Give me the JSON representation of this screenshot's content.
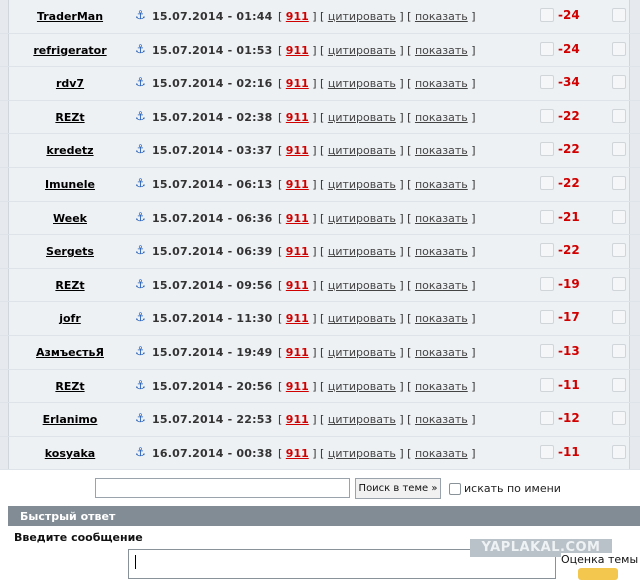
{
  "posts": [
    {
      "user": "TraderMan",
      "anchor": "⚓",
      "date": "15.07.2014 - 01:44",
      "n911": "911",
      "quote": "цитировать",
      "show": "показать",
      "score": "-24"
    },
    {
      "user": "refrigerator",
      "anchor": "⚓",
      "date": "15.07.2014 - 01:53",
      "n911": "911",
      "quote": "цитировать",
      "show": "показать",
      "score": "-24"
    },
    {
      "user": "rdv7",
      "anchor": "⚓",
      "date": "15.07.2014 - 02:16",
      "n911": "911",
      "quote": "цитировать",
      "show": "показать",
      "score": "-34"
    },
    {
      "user": "REZt",
      "anchor": "⚓",
      "date": "15.07.2014 - 02:38",
      "n911": "911",
      "quote": "цитировать",
      "show": "показать",
      "score": "-22"
    },
    {
      "user": "kredetz",
      "anchor": "⚓",
      "date": "15.07.2014 - 03:37",
      "n911": "911",
      "quote": "цитировать",
      "show": "показать",
      "score": "-22"
    },
    {
      "user": "Imunele",
      "anchor": "⚓",
      "date": "15.07.2014 - 06:13",
      "n911": "911",
      "quote": "цитировать",
      "show": "показать",
      "score": "-22"
    },
    {
      "user": "Week",
      "anchor": "⚓",
      "date": "15.07.2014 - 06:36",
      "n911": "911",
      "quote": "цитировать",
      "show": "показать",
      "score": "-21"
    },
    {
      "user": "Sergets",
      "anchor": "⚓",
      "date": "15.07.2014 - 06:39",
      "n911": "911",
      "quote": "цитировать",
      "show": "показать",
      "score": "-22"
    },
    {
      "user": "REZt",
      "anchor": "⚓",
      "date": "15.07.2014 - 09:56",
      "n911": "911",
      "quote": "цитировать",
      "show": "показать",
      "score": "-19"
    },
    {
      "user": "jofr",
      "anchor": "⚓",
      "date": "15.07.2014 - 11:30",
      "n911": "911",
      "quote": "цитировать",
      "show": "показать",
      "score": "-17"
    },
    {
      "user": "АзмъестьЯ",
      "anchor": "⚓",
      "date": "15.07.2014 - 19:49",
      "n911": "911",
      "quote": "цитировать",
      "show": "показать",
      "score": "-13"
    },
    {
      "user": "REZt",
      "anchor": "⚓",
      "date": "15.07.2014 - 20:56",
      "n911": "911",
      "quote": "цитировать",
      "show": "показать",
      "score": "-11"
    },
    {
      "user": "Erlanimo",
      "anchor": "⚓",
      "date": "15.07.2014 - 22:53",
      "n911": "911",
      "quote": "цитировать",
      "show": "показать",
      "score": "-12"
    },
    {
      "user": "kosyaka",
      "anchor": "⚓",
      "date": "16.07.2014 - 00:38",
      "n911": "911",
      "quote": "цитировать",
      "show": "показать",
      "score": "-11"
    }
  ],
  "search": {
    "input_value": "",
    "button_label": "Поиск в теме »",
    "by_name_label": "искать по имени"
  },
  "quick_reply": {
    "title": "Быстрый ответ",
    "message_label": "Введите сообщение",
    "message_value": ""
  },
  "watermark": "YAPLAKAL.COM",
  "rating_label": "Оценка темы",
  "colors": {
    "score": "#d00000",
    "link_911": "#d00000",
    "header_bg": "#828c94",
    "row_bg": "#eef1f4",
    "rating_button": "#f3c64e"
  }
}
